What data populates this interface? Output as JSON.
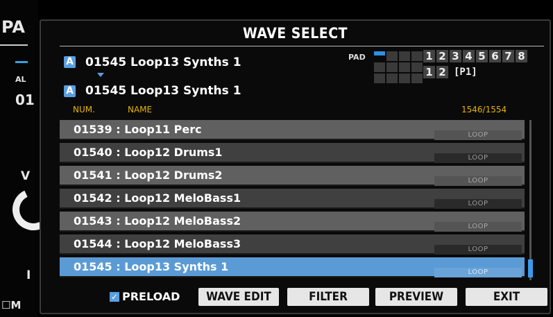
{
  "background": {
    "left_texts": [
      "PA",
      "AL",
      "01",
      "V",
      "I"
    ],
    "bottom_checkbox_label": "M"
  },
  "dialog": {
    "title": "WAVE SELECT",
    "current": {
      "bank": "A",
      "name": "01545 Loop13 Synths 1"
    },
    "next": {
      "bank": "A",
      "name": "01545 Loop13 Synths 1"
    },
    "pad": {
      "label": "PAD",
      "row1": [
        "1",
        "2",
        "3",
        "4",
        "5",
        "6",
        "7",
        "8"
      ],
      "row2": [
        "1",
        "2"
      ],
      "row2_suffix": "[P1]"
    },
    "columns": {
      "num": "NUM.",
      "name": "NAME",
      "count": "1546/1554"
    },
    "rows": [
      {
        "text": "01539 : Loop11 Perc",
        "tag": "LOOP",
        "selected": false
      },
      {
        "text": "01540 : Loop12 Drums1",
        "tag": "LOOP",
        "selected": false
      },
      {
        "text": "01541 : Loop12 Drums2",
        "tag": "LOOP",
        "selected": false
      },
      {
        "text": "01542 : Loop12 MeloBass1",
        "tag": "LOOP",
        "selected": false
      },
      {
        "text": "01543 : Loop12 MeloBass2",
        "tag": "LOOP",
        "selected": false
      },
      {
        "text": "01544 : Loop12 MeloBass3",
        "tag": "LOOP",
        "selected": false
      },
      {
        "text": "01545 : Loop13 Synths 1",
        "tag": "LOOP",
        "selected": true
      }
    ],
    "footer": {
      "preload_label": "PRELOAD",
      "preload_checked": true,
      "buttons": [
        "WAVE EDIT",
        "FILTER",
        "PREVIEW",
        "EXIT"
      ]
    }
  },
  "colors": {
    "accent": "#5b9bd5",
    "header_yellow": "#e6b400",
    "button_bg": "#e6e6e6"
  }
}
